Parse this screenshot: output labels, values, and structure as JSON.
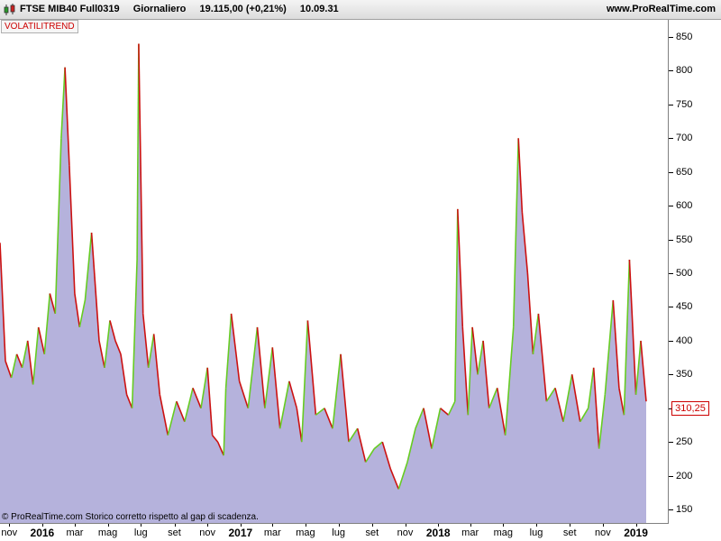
{
  "header": {
    "instrument": "FTSE MIB40 Full0319",
    "timeframe": "Giornaliero",
    "quote": "19.115,00 (+0,21%)",
    "time": "10.09.31",
    "site": "www.ProRealTime.com"
  },
  "indicator_label": "VOLATILITREND",
  "copyright": "© ProRealTime.com  Storico corretto rispetto al gap di scadenza.",
  "last_value": "310,25",
  "colors": {
    "fill": "#b5b2dc",
    "rising": "#66cc22",
    "falling": "#cc1111",
    "label_red": "#cc0000"
  },
  "chart_data": {
    "type": "area",
    "ylim": [
      130,
      870
    ],
    "y_ticks": [
      "850",
      "800",
      "750",
      "700",
      "650",
      "600",
      "550",
      "500",
      "450",
      "400",
      "350",
      "300",
      "250",
      "200",
      "150"
    ],
    "x_labels": [
      "nov",
      "2016",
      "mar",
      "mag",
      "lug",
      "set",
      "nov",
      "2017",
      "mar",
      "mag",
      "lug",
      "set",
      "nov",
      "2018",
      "mar",
      "mag",
      "lug",
      "set",
      "nov",
      "2019"
    ],
    "x_major": [
      "2016",
      "2017",
      "2018",
      "2019"
    ],
    "x_range": [
      "2015-10-15",
      "2019-01-25"
    ],
    "x_label_dates": [
      "2015-11-01",
      "2016-01-01",
      "2016-03-01",
      "2016-05-01",
      "2016-07-01",
      "2016-09-01",
      "2016-11-01",
      "2017-01-01",
      "2017-03-01",
      "2017-05-01",
      "2017-07-01",
      "2017-09-01",
      "2017-11-01",
      "2018-01-01",
      "2018-03-01",
      "2018-05-01",
      "2018-07-01",
      "2018-09-01",
      "2018-11-01",
      "2019-01-01"
    ],
    "series": [
      {
        "x": [
          "2015-10-15",
          "2015-10-25",
          "2015-11-05",
          "2015-11-15",
          "2015-11-25",
          "2015-12-05",
          "2015-12-15",
          "2015-12-25",
          "2016-01-05",
          "2016-01-15",
          "2016-01-25",
          "2016-02-05",
          "2016-02-12",
          "2016-02-20",
          "2016-03-01",
          "2016-03-10",
          "2016-03-20",
          "2016-04-01",
          "2016-04-15",
          "2016-04-25",
          "2016-05-05",
          "2016-05-15",
          "2016-05-25",
          "2016-06-05",
          "2016-06-15",
          "2016-06-24",
          "2016-06-27",
          "2016-07-05",
          "2016-07-15",
          "2016-07-25",
          "2016-08-05",
          "2016-08-20",
          "2016-09-05",
          "2016-09-20",
          "2016-10-05",
          "2016-10-20",
          "2016-11-01",
          "2016-11-10",
          "2016-11-20",
          "2016-12-01",
          "2016-12-05",
          "2016-12-15",
          "2016-12-30",
          "2017-01-15",
          "2017-02-01",
          "2017-02-15",
          "2017-03-01",
          "2017-03-15",
          "2017-04-01",
          "2017-04-15",
          "2017-04-24",
          "2017-05-05",
          "2017-05-20",
          "2017-06-05",
          "2017-06-20",
          "2017-07-05",
          "2017-07-20",
          "2017-08-05",
          "2017-08-20",
          "2017-09-05",
          "2017-09-20",
          "2017-10-05",
          "2017-10-20",
          "2017-11-05",
          "2017-11-20",
          "2017-12-05",
          "2017-12-20",
          "2018-01-05",
          "2018-01-20",
          "2018-02-01",
          "2018-02-06",
          "2018-02-15",
          "2018-02-25",
          "2018-03-05",
          "2018-03-15",
          "2018-03-25",
          "2018-04-05",
          "2018-04-20",
          "2018-05-05",
          "2018-05-20",
          "2018-05-29",
          "2018-06-05",
          "2018-06-15",
          "2018-06-25",
          "2018-07-05",
          "2018-07-20",
          "2018-08-05",
          "2018-08-20",
          "2018-09-05",
          "2018-09-20",
          "2018-10-05",
          "2018-10-15",
          "2018-10-25",
          "2018-11-05",
          "2018-11-20",
          "2018-12-01",
          "2018-12-10",
          "2018-12-20",
          "2019-01-01",
          "2019-01-10",
          "2019-01-20"
        ],
        "y": [
          545,
          370,
          345,
          380,
          360,
          400,
          335,
          420,
          380,
          470,
          440,
          700,
          805,
          660,
          470,
          420,
          460,
          560,
          400,
          360,
          430,
          400,
          380,
          320,
          300,
          520,
          840,
          440,
          360,
          410,
          320,
          260,
          310,
          280,
          330,
          300,
          360,
          260,
          250,
          230,
          330,
          440,
          340,
          300,
          420,
          300,
          390,
          270,
          340,
          300,
          250,
          430,
          290,
          300,
          270,
          380,
          250,
          270,
          220,
          240,
          250,
          210,
          180,
          220,
          270,
          300,
          240,
          300,
          290,
          310,
          595,
          420,
          290,
          420,
          350,
          400,
          300,
          330,
          260,
          420,
          700,
          590,
          500,
          380,
          440,
          310,
          330,
          280,
          350,
          280,
          300,
          360,
          240,
          320,
          460,
          330,
          290,
          520,
          320,
          400,
          310
        ]
      }
    ]
  }
}
